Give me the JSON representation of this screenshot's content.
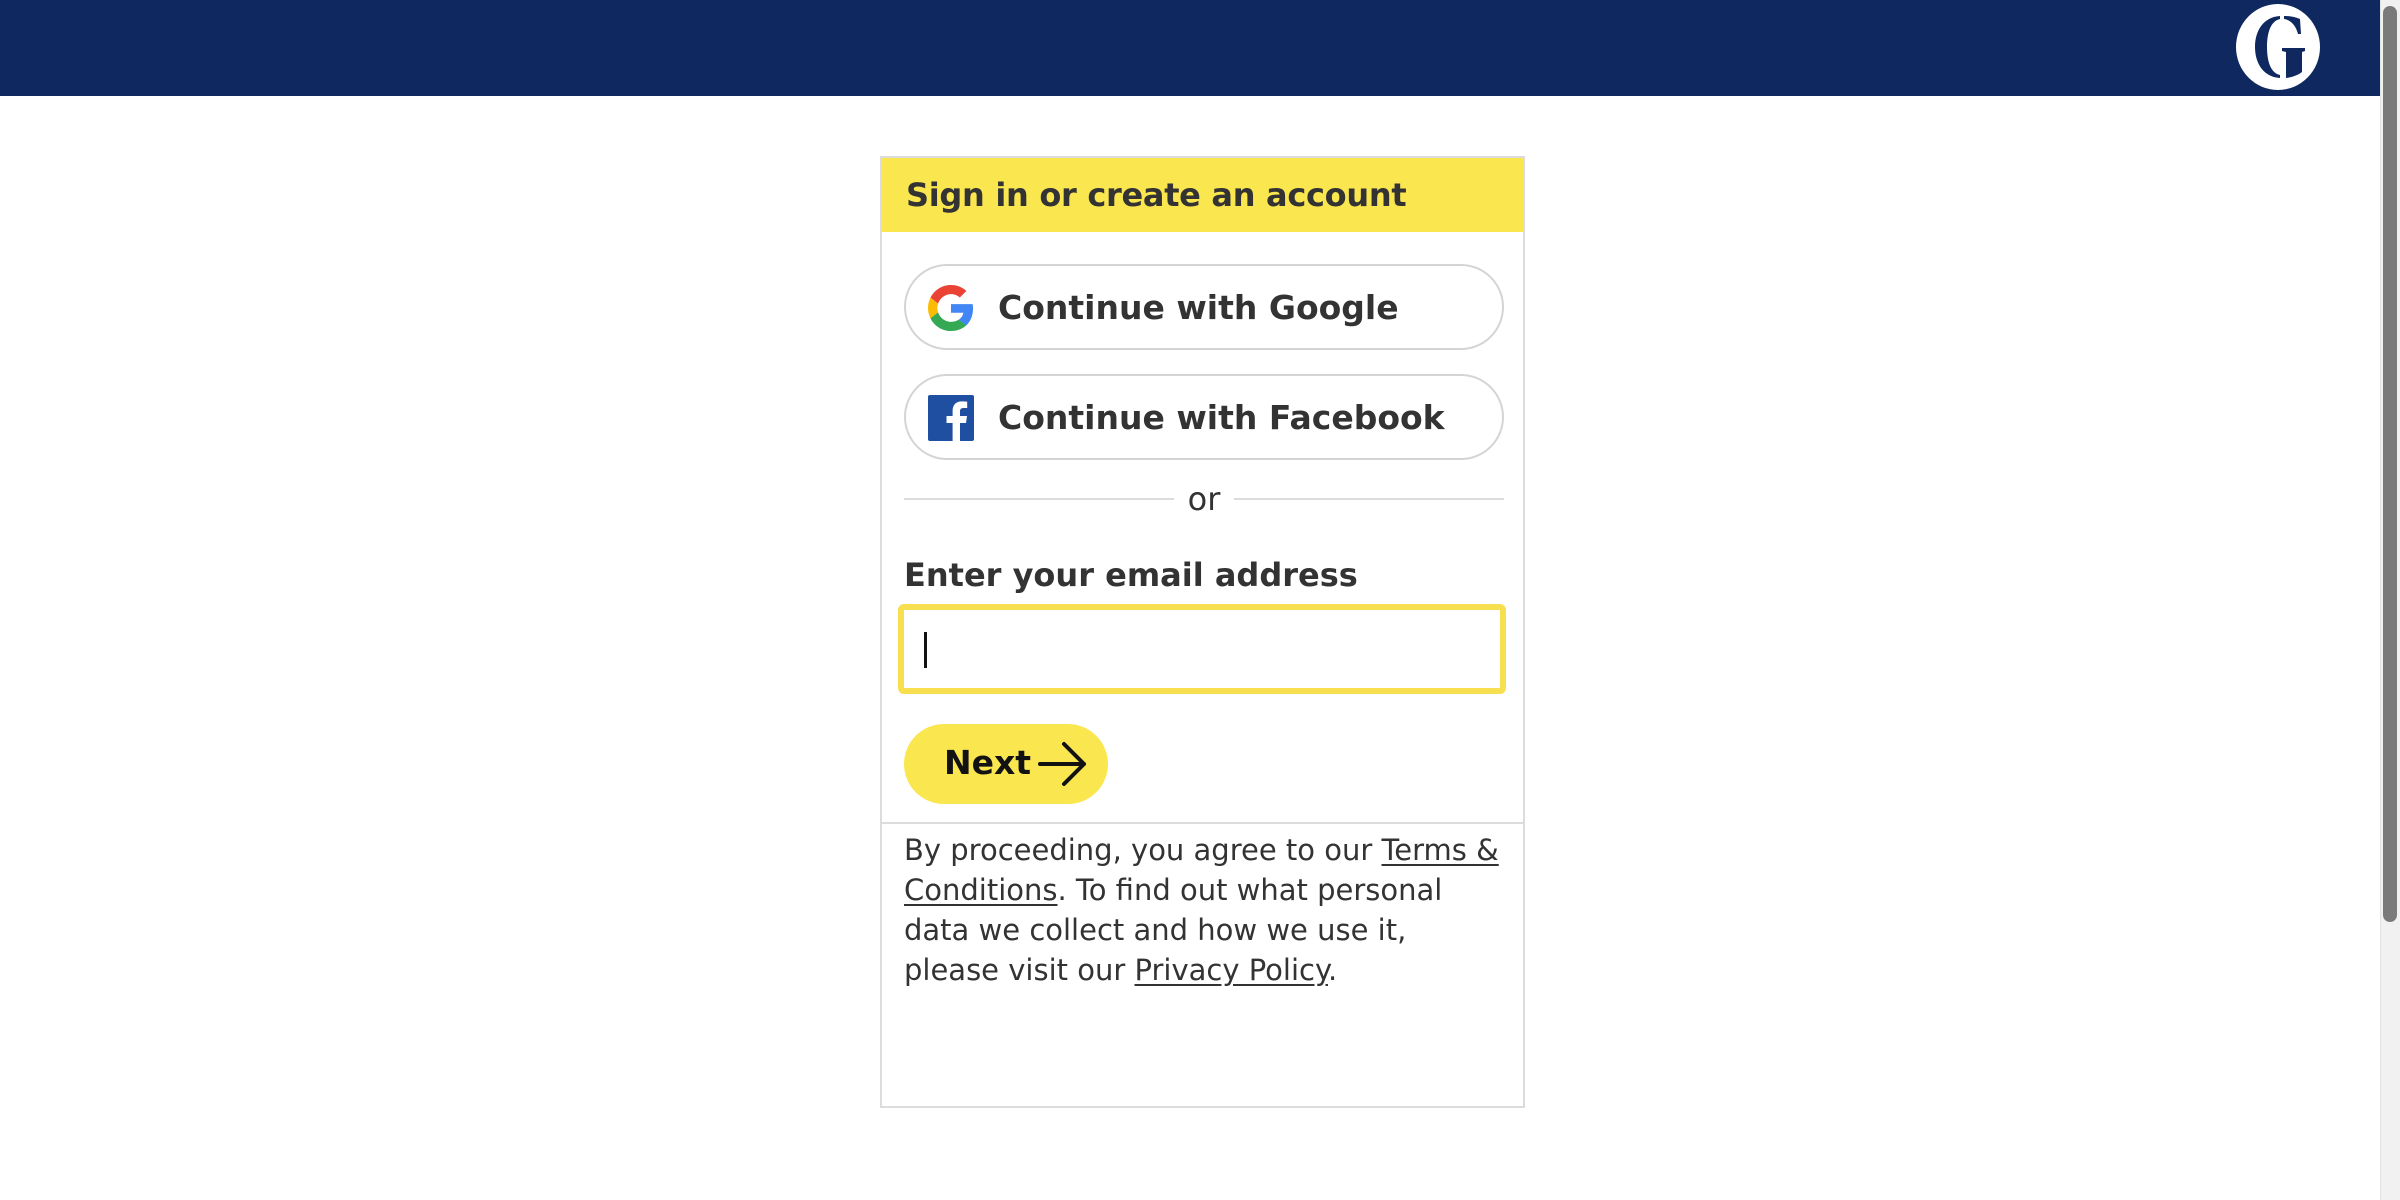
{
  "header": {
    "logo": "guardian-g-logo",
    "background_color": "#0f2960"
  },
  "card": {
    "title": "Sign in or create an account",
    "accent_color": "#fae64f",
    "google_label": "Continue with Google",
    "facebook_label": "Continue with Facebook",
    "divider_text": "or",
    "email_label": "Enter your email address",
    "email_value": "",
    "next_label": "Next",
    "legal": {
      "text_before_terms": "By proceeding, you agree to our ",
      "terms_link": "Terms & Conditions",
      "text_middle": ". To find out what personal data we collect and how we use it, please visit our ",
      "privacy_link": "Privacy Policy",
      "text_end": "."
    }
  },
  "icons": {
    "google": "google-icon",
    "facebook": "facebook-icon",
    "next": "arrow-right-icon"
  }
}
